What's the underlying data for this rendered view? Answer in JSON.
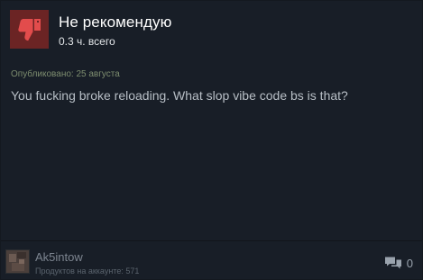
{
  "review": {
    "verdict": "Не рекомендую",
    "hours": "0.3 ч. всего",
    "posted": "Опубликовано: 25 августа",
    "body": "You fucking broke reloading. What slop vibe code bs is that?"
  },
  "author": {
    "name": "Ak5intow",
    "products": "Продуктов на аккаунте: 571"
  },
  "comments": {
    "count": "0",
    "icon": "comment-bubble-icon"
  },
  "icons": {
    "verdict": "thumbs-down-icon"
  },
  "colors": {
    "verdict_bg": "#6b2424",
    "thumb": "#e24c4c",
    "card_bg": "#181e27",
    "posted_text": "#7d8d6f"
  }
}
